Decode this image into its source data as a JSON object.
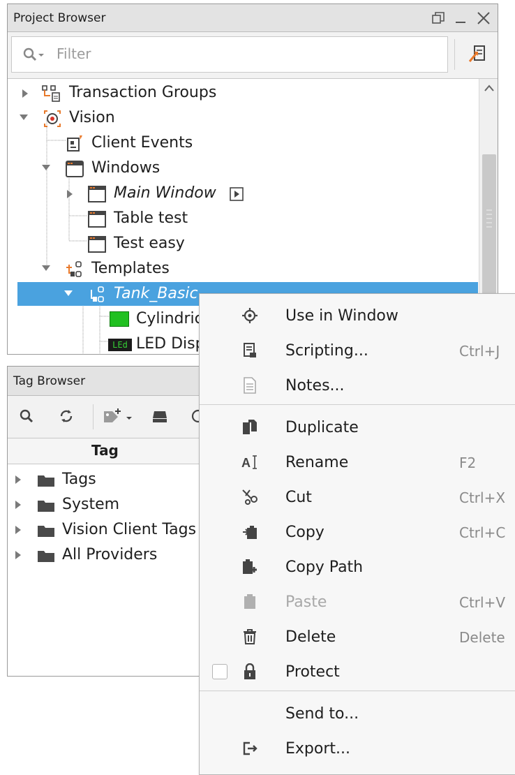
{
  "project_browser": {
    "title": "Project Browser",
    "filter_placeholder": "Filter",
    "tree": [
      {
        "label": "Transaction Groups",
        "icon": "transaction-groups-icon"
      },
      {
        "label": "Vision",
        "icon": "vision-icon"
      },
      {
        "label": "Client Events",
        "icon": "client-events-icon"
      },
      {
        "label": "Windows",
        "icon": "windows-folder-icon"
      },
      {
        "label": "Main Window",
        "icon": "window-icon"
      },
      {
        "label": "Table test",
        "icon": "window-icon"
      },
      {
        "label": "Test easy",
        "icon": "window-icon"
      },
      {
        "label": "Templates",
        "icon": "templates-icon"
      },
      {
        "label": "Tank_Basic",
        "icon": "template-icon"
      },
      {
        "label": "Cylindric",
        "icon": "cylindrical-tank-icon"
      },
      {
        "label": "LED Disp",
        "icon": "led-display-icon",
        "icon_text": "LEd"
      }
    ]
  },
  "tag_browser": {
    "title": "Tag Browser",
    "column_header": "Tag",
    "rows": [
      "Tags",
      "System",
      "Vision Client Tags",
      "All Providers"
    ]
  },
  "context_menu": {
    "items": [
      {
        "label": "Use in Window",
        "shortcut": "",
        "icon": "target-icon"
      },
      {
        "label": "Scripting...",
        "shortcut": "Ctrl+J",
        "icon": "script-icon"
      },
      {
        "label": "Notes...",
        "shortcut": "",
        "icon": "notes-icon"
      },
      {
        "label": "Duplicate",
        "shortcut": "",
        "icon": "duplicate-icon"
      },
      {
        "label": "Rename",
        "shortcut": "F2",
        "icon": "rename-icon"
      },
      {
        "label": "Cut",
        "shortcut": "Ctrl+X",
        "icon": "scissors-icon"
      },
      {
        "label": "Copy",
        "shortcut": "Ctrl+C",
        "icon": "copy-icon"
      },
      {
        "label": "Copy Path",
        "shortcut": "",
        "icon": "copy-path-icon"
      },
      {
        "label": "Paste",
        "shortcut": "Ctrl+V",
        "icon": "paste-icon",
        "disabled": true
      },
      {
        "label": "Delete",
        "shortcut": "Delete",
        "icon": "trash-icon"
      },
      {
        "label": "Protect",
        "shortcut": "",
        "icon": "lock-icon",
        "checked": false
      },
      {
        "label": "Send to...",
        "shortcut": "",
        "icon": ""
      },
      {
        "label": "Export...",
        "shortcut": "",
        "icon": "export-icon"
      }
    ]
  },
  "colors": {
    "selection": "#4aa2df",
    "orange_accent": "#e8792b",
    "tank_green": "#20c020"
  }
}
